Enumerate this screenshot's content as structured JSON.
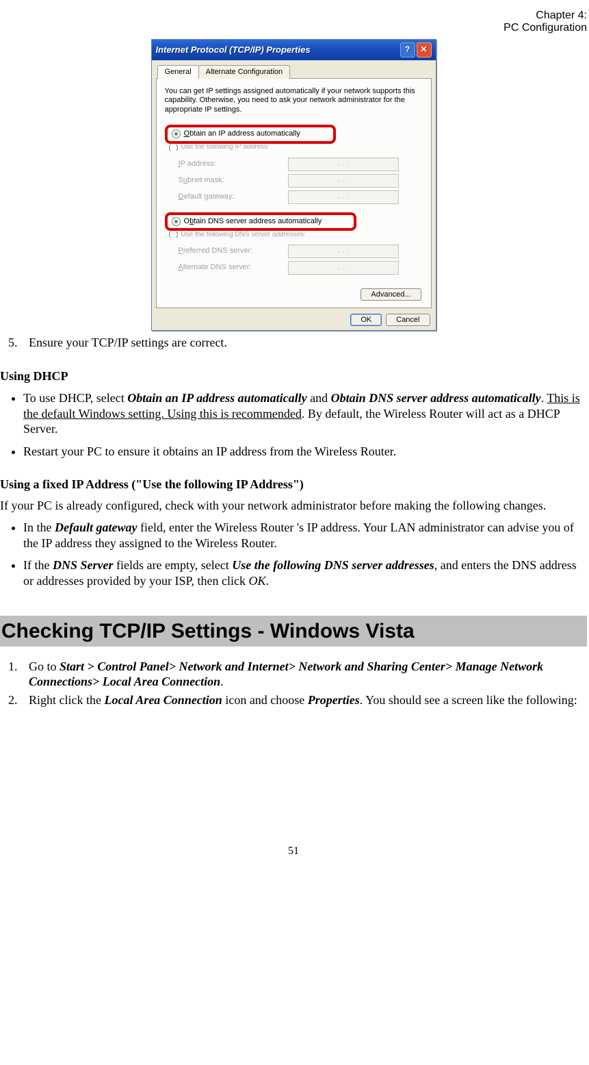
{
  "header": {
    "line1": "Chapter 4:",
    "line2": "PC Configuration"
  },
  "dialog": {
    "title": "Internet Protocol (TCP/IP) Properties",
    "help_glyph": "?",
    "close_glyph": "✕",
    "tabs": {
      "general": "General",
      "alt": "Alternate Configuration"
    },
    "intro": "You can get IP settings assigned automatically if your network supports this capability. Otherwise, you need to ask your network administrator for the appropriate IP settings.",
    "r1": {
      "underline_char": "O",
      "rest": "btain an IP address automatically"
    },
    "r1b": "Use the following IP address:",
    "fields1": {
      "ip": "IP address:",
      "subnet": "Subnet mask:",
      "gateway": "Default gateway:"
    },
    "r2": {
      "pre": "Obtain DNS server address automatically"
    },
    "r2_underline": "b",
    "r2_rest": "tain DNS server address automatically",
    "r2_prefix": "O",
    "r2b": "Use the following DNS server addresses:",
    "fields2": {
      "pref": "Preferred DNS server:",
      "alt": "Alternate DNS server:"
    },
    "advanced": "Advanced...",
    "ok": "OK",
    "cancel": "Cancel",
    "dots": ".     .     ."
  },
  "step5": {
    "num": "5.",
    "text": "Ensure your TCP/IP settings are correct."
  },
  "dhcp": {
    "heading": "Using DHCP",
    "b1_a": "To use DHCP, select ",
    "b1_bi1": "Obtain an IP address automatically",
    "b1_mid": " and ",
    "b1_bi2": "Obtain DNS server address automatically",
    "b1_b": ". ",
    "b1_under": "This is the default Windows setting. Using this is recommended",
    "b1_c": ". By default, the Wireless Router will act as a DHCP Server.",
    "b2": "Restart your PC to ensure it obtains an IP address from the Wireless Router."
  },
  "fixed": {
    "heading": "Using a fixed IP Address (\"Use the following IP Address\")",
    "intro": "If your PC is already configured, check with your network administrator before making the following changes.",
    "b1_a": "In the ",
    "b1_bi": "Default gateway",
    "b1_b": " field, enter the Wireless Router 's IP address. Your LAN administrator can advise you of the IP address they assigned to the Wireless Router.",
    "b2_a": "If the ",
    "b2_bi1": "DNS Server",
    "b2_b": " fields are empty, select ",
    "b2_bi2": "Use the following DNS server addresses",
    "b2_c": ", and enters the DNS address or addresses provided by your ISP, then click ",
    "b2_i": "OK",
    "b2_d": "."
  },
  "section": "Checking TCP/IP Settings - Windows Vista",
  "vista": {
    "s1_num": "1.",
    "s1_a": "Go to ",
    "s1_bi": "Start > Control Panel> Network and Internet>  Network and Sharing Center> Manage Network Connections> Local Area Connection",
    "s1_b": ".",
    "s2_num": "2.",
    "s2_a": "Right click the ",
    "s2_bi1": "Local Area Connection",
    "s2_b": " icon and choose ",
    "s2_bi2": "Properties",
    "s2_c": ". You should see a screen like the following:"
  },
  "pagenum": "51"
}
